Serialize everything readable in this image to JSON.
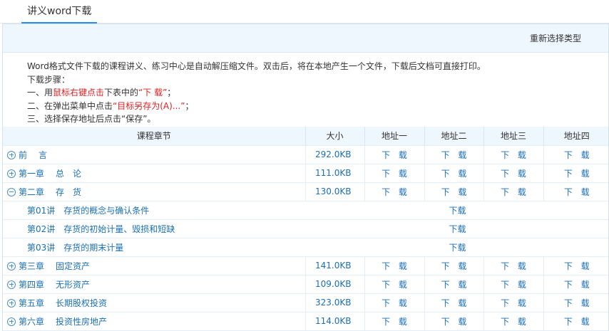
{
  "tab": {
    "title": "讲义word下载"
  },
  "topbar": {
    "reselect_label": "重新选择类型"
  },
  "notes": {
    "line1": "Word格式文件下载的课程讲义、练习中心是自动解压缩文件。双击后，将在本地产生一个文件，下载后文档可直接打印。",
    "line2": "下载步骤：",
    "line3_a": "一、用",
    "line3_red": "鼠标右键点击",
    "line3_b": "下表中的",
    "line3_red2": "“下 载”",
    "line3_c": "；",
    "line4_a": "二、在弹出菜单中点击",
    "line4_red": "“目标另存为(A)...”",
    "line4_c": "；",
    "line5": "三、选择保存地址后点击“保存”。"
  },
  "table": {
    "headers": [
      "课程章节",
      "大小",
      "地址一",
      "地址二",
      "地址三",
      "地址四"
    ],
    "download_label": "下 载",
    "sub_download_label": "下载",
    "rows": [
      {
        "a": "前",
        "b": "言",
        "size": "292.0KB",
        "expanded": false
      },
      {
        "a": "第一章",
        "b": "总　论",
        "size": "111.0KB",
        "expanded": false
      },
      {
        "a": "第二章",
        "b": "存　货",
        "size": "130.0KB",
        "expanded": true
      },
      {
        "a": "第三章",
        "b": "固定资产",
        "size": "141.0KB",
        "expanded": false
      },
      {
        "a": "第四章",
        "b": "无形资产",
        "size": "109.0KB",
        "expanded": false
      },
      {
        "a": "第五章",
        "b": "长期股权投资",
        "size": "323.0KB",
        "expanded": false
      },
      {
        "a": "第六章",
        "b": "投资性房地产",
        "size": "114.0KB",
        "expanded": false
      }
    ],
    "subrows": [
      {
        "a": "第01讲",
        "b": "存货的概念与确认条件"
      },
      {
        "a": "第02讲",
        "b": "存货的初始计量、毁损和短缺"
      },
      {
        "a": "第03讲",
        "b": "存货的期末计量"
      }
    ]
  }
}
